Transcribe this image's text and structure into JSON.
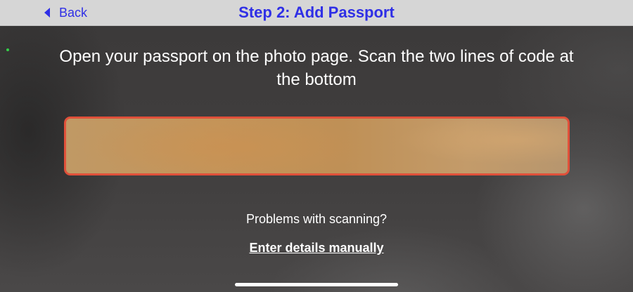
{
  "nav": {
    "back_label": "Back",
    "back_icon": "chevron-left-icon",
    "title": "Step 2: Add Passport"
  },
  "scan": {
    "instruction": "Open your passport on the photo page. Scan the two lines of code at the bottom",
    "problems_text": "Problems with scanning?",
    "manual_link_label": "Enter details manually"
  },
  "colors": {
    "accent": "#2f2fe6",
    "nav_background": "#d6d6d6",
    "scan_frame_border": "#e0503a",
    "status_dot": "#35d04a"
  }
}
